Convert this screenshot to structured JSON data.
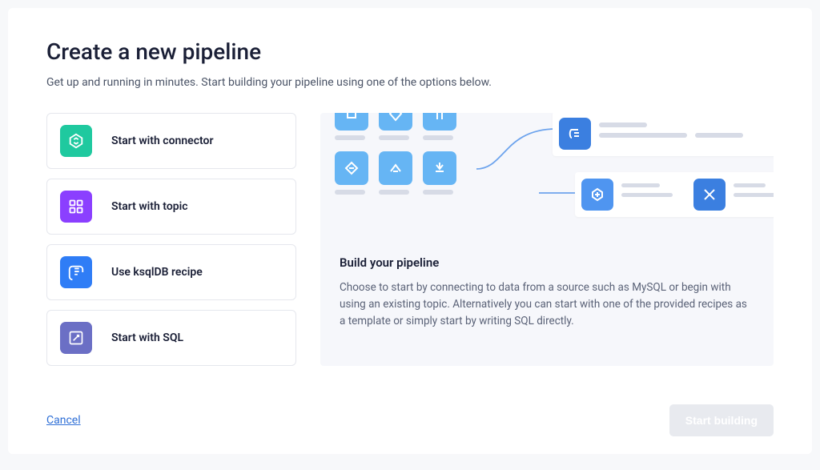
{
  "header": {
    "title": "Create a new pipeline",
    "subtitle": "Get up and running in minutes. Start building your pipeline using one of the options below."
  },
  "options": [
    {
      "label": "Start with connector",
      "icon": "connector"
    },
    {
      "label": "Start with topic",
      "icon": "topic"
    },
    {
      "label": "Use ksqlDB recipe",
      "icon": "recipe"
    },
    {
      "label": "Start with SQL",
      "icon": "sql"
    }
  ],
  "preview": {
    "title": "Build your pipeline",
    "description": "Choose to start by connecting to data from a source such as MySQL or begin with using an existing topic. Alternatively you can start with one of the provided recipes as a template or simply start by writing SQL directly."
  },
  "footer": {
    "cancel_label": "Cancel",
    "start_label": "Start building"
  }
}
